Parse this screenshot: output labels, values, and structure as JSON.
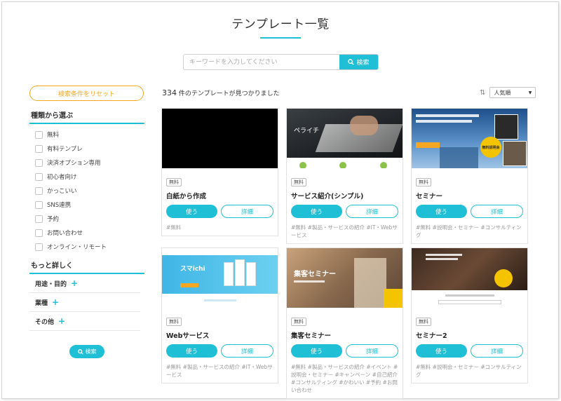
{
  "header": {
    "title": "テンプレート一覧"
  },
  "search": {
    "placeholder": "キーワードを入力してください",
    "button_label": "検索"
  },
  "sidebar": {
    "reset_label": "検索条件をリセット",
    "type_heading": "種類から選ぶ",
    "types": [
      "無料",
      "有料テンプレ",
      "決済オプション専用",
      "初心者向け",
      "かっこいい",
      "SNS連携",
      "予約",
      "お問い合わせ",
      "オンライン・リモート"
    ],
    "more_heading": "もっと詳しく",
    "more_items": [
      "用途・目的",
      "業種",
      "その他"
    ],
    "search_label": "検索"
  },
  "results": {
    "count": "334",
    "suffix": "件のテンプレートが見つかりました",
    "sort_value": "人気順"
  },
  "cards": [
    {
      "badge": "無料",
      "title": "白紙から作成",
      "use": "使う",
      "detail": "詳細",
      "tags": "#無料"
    },
    {
      "badge": "無料",
      "title": "サービス紹介(シンプル)",
      "use": "使う",
      "detail": "詳細",
      "tags": "#無料 #製品・サービスの紹介 #IT・Webサービス"
    },
    {
      "badge": "無料",
      "title": "セミナー",
      "use": "使う",
      "detail": "詳細",
      "tags": "#無料 #説明会・セミナー #コンサルティング"
    },
    {
      "badge": "無料",
      "title": "Webサービス",
      "use": "使う",
      "detail": "詳細",
      "tags": "#無料 #製品・サービスの紹介 #IT・Webサービス"
    },
    {
      "badge": "無料",
      "title": "集客セミナー",
      "use": "使う",
      "detail": "詳細",
      "tags": "#無料 #製品・サービスの紹介 #イベント #説明会・セミナー #キャンペーン #自己紹介 #コンサルティング #かわいい #予約 #お問い合わせ"
    },
    {
      "badge": "無料",
      "title": "セミナー2",
      "use": "使う",
      "detail": "詳細",
      "tags": "#無料 #説明会・セミナー #コンサルティング"
    }
  ],
  "thumbs": {
    "t2_text": "ペライチ",
    "t3_text": "無料説明会",
    "t4_text": "スマichi",
    "t5_text": "集客セミナー"
  },
  "colors": {
    "accent": "#1fbfd6",
    "reset": "#f5a623"
  }
}
